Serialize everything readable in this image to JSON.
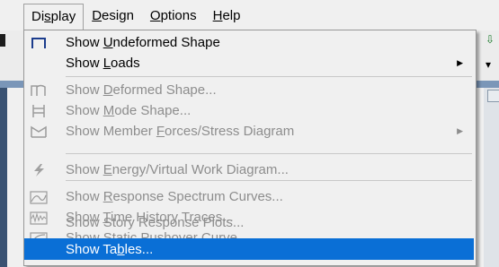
{
  "menubar": {
    "items": [
      {
        "label_pre": "Di",
        "label_mn": "s",
        "label_post": "play"
      },
      {
        "label_pre": "",
        "label_mn": "D",
        "label_post": "esign"
      },
      {
        "label_pre": "",
        "label_mn": "O",
        "label_post": "ptions"
      },
      {
        "label_pre": "",
        "label_mn": "H",
        "label_post": "elp"
      }
    ]
  },
  "display_menu": {
    "items": [
      {
        "pre": "Show ",
        "mn": "U",
        "post": "ndeformed Shape",
        "icon": "undeformed-shape-icon"
      },
      {
        "pre": "Show ",
        "mn": "L",
        "post": "oads",
        "icon": ""
      },
      {
        "pre": "Show ",
        "mn": "D",
        "post": "eformed Shape...",
        "icon": "deformed-shape-icon"
      },
      {
        "pre": "Show ",
        "mn": "M",
        "post": "ode Shape...",
        "icon": "mode-shape-icon"
      },
      {
        "pre": "Show Member ",
        "mn": "F",
        "post": "orces/Stress Diagram",
        "icon": "member-forces-icon"
      },
      {
        "pre": "Show ",
        "mn": "E",
        "post": "nergy/Virtual Work Diagram...",
        "icon": "energy-icon"
      },
      {
        "pre": "Show ",
        "mn": "R",
        "post": "esponse Spectrum Curves...",
        "icon": "response-spectrum-icon"
      },
      {
        "pre": "Show ",
        "mn": "T",
        "post": "ime History Traces...",
        "icon": "time-history-icon"
      },
      {
        "pre": "Show Static Pushover ",
        "mn": "C",
        "post": "urve...",
        "icon": "pushover-curve-icon"
      },
      {
        "pre": "Show Story Response Plots...",
        "mn": "",
        "post": "",
        "icon": ""
      },
      {
        "pre": "Show Ta",
        "mn": "b",
        "post": "les...",
        "icon": ""
      }
    ]
  }
}
